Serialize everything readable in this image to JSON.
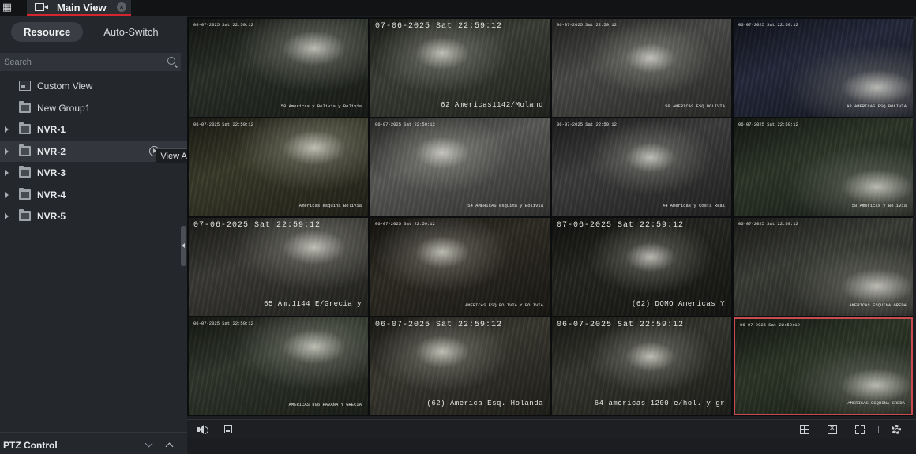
{
  "tab": {
    "label": "Main View"
  },
  "left_panel": {
    "segments": [
      "Resource",
      "Auto-Switch"
    ],
    "active_segment": "Resource",
    "search": {
      "placeholder": "Search",
      "value": ""
    },
    "tree": [
      {
        "label": "Custom View",
        "icon": "custom-view-icon",
        "expandable": false,
        "bold": false
      },
      {
        "label": "New Group1",
        "icon": "folder-icon",
        "expandable": false,
        "bold": false
      },
      {
        "label": "NVR-1",
        "icon": "folder-icon",
        "expandable": true,
        "bold": true
      },
      {
        "label": "NVR-2",
        "icon": "folder-icon",
        "expandable": true,
        "bold": true,
        "hovered": true
      },
      {
        "label": "NVR-3",
        "icon": "folder-icon",
        "expandable": true,
        "bold": true
      },
      {
        "label": "NVR-4",
        "icon": "folder-icon",
        "expandable": true,
        "bold": true
      },
      {
        "label": "NVR-5",
        "icon": "folder-icon",
        "expandable": true,
        "bold": true
      }
    ],
    "tooltip": "View All Cameras in Group",
    "ptz_label": "PTZ Control"
  },
  "cameras": [
    {
      "top": "06-07-2025 Sat 22:59:12",
      "top_size": "small",
      "bottom": "58 Americas y Bolivia y Bolivia",
      "bottom_size": "small",
      "bg": "#2a2f28"
    },
    {
      "top": "07-06-2025 Sat 22:59:12",
      "top_size": "big",
      "bottom": "62 Americas1142/Moland",
      "bottom_size": "big",
      "bg": "#3a3e35"
    },
    {
      "top": "06-07-2025 Sat 22:59:12",
      "top_size": "small",
      "bottom": "58 AMERICAS ESQ BOLIVIA",
      "bottom_size": "small",
      "bg": "#4a4a48"
    },
    {
      "top": "06-07-2025 Sat 22:59:12",
      "top_size": "small",
      "bottom": "A3 AMERICAS ESQ BOLIVIA",
      "bottom_size": "small",
      "bg": "#24283a"
    },
    {
      "top": "06-07-2025 Sat 22:59:12",
      "top_size": "small",
      "bottom": "Americas esquina Bolivia",
      "bottom_size": "small",
      "bg": "#3a3a2a"
    },
    {
      "top": "06-07-2025 Sat 22:59:12",
      "top_size": "small",
      "bottom": "54 AMERICAS esquina y Bolivia",
      "bottom_size": "small",
      "bg": "#5a5a58"
    },
    {
      "top": "06-07-2025 Sat 22:59:12",
      "top_size": "small",
      "bottom": "44 Americas y Costa Real",
      "bottom_size": "small",
      "bg": "#3c3d3c"
    },
    {
      "top": "06-07-2025 Sat 22:59:12",
      "top_size": "small",
      "bottom": "58 Americas y Bolivia",
      "bottom_size": "small",
      "bg": "#2c3528"
    },
    {
      "top": "07-06-2025 Sat 22:59:12",
      "top_size": "big",
      "bottom": "65 Am.1144 E/Grecia y",
      "bottom_size": "big",
      "bg": "#3a3935"
    },
    {
      "top": "06-07-2025 Sat 22:59:12",
      "top_size": "small",
      "bottom": "AMERICAS ESQ BOLIVIA Y BOLIVIA",
      "bottom_size": "small",
      "bg": "#2e2b23"
    },
    {
      "top": "07-06-2025 Sat 22:59:12",
      "top_size": "big",
      "bottom": "(62) DOMO Americas Y",
      "bottom_size": "big",
      "bg": "#242420"
    },
    {
      "top": "06-07-2025 Sat 22:59:12",
      "top_size": "small",
      "bottom": "AMERICAS ESQUINA GREDA",
      "bottom_size": "small",
      "bg": "#3a3c36"
    },
    {
      "top": "06-07-2025 Sat 22:59:12",
      "top_size": "small",
      "bottom": "AMERICAS 806 HAVANA Y GRECIA",
      "bottom_size": "small",
      "bg": "#30362b"
    },
    {
      "top": "06-07-2025 Sat 22:59:12",
      "top_size": "big",
      "bottom": "(62) America Esq. Holanda",
      "bottom_size": "big",
      "bg": "#38372f"
    },
    {
      "top": "06-07-2025 Sat 22:59:12",
      "top_size": "big",
      "bottom": "64 americas 1200 e/hol. y gr",
      "bottom_size": "big",
      "bg": "#34352e"
    },
    {
      "top": "06-07-2025 Sat 22:59:12",
      "top_size": "small",
      "bottom": "AMERICAS ESQUINA GREDA",
      "bottom_size": "small",
      "bg": "#2d3527",
      "selected": true
    }
  ],
  "toolbar_icons": [
    "volume-icon",
    "save-icon",
    "layout-icon",
    "close-all-icon",
    "fullscreen-icon",
    "settings-icon"
  ]
}
